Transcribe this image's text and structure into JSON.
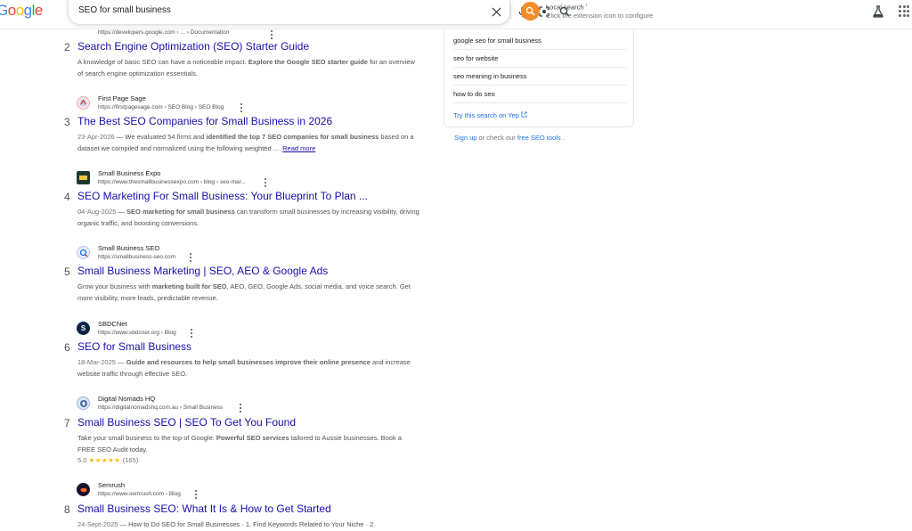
{
  "header": {
    "logo_text": "Google",
    "search_value": "SEO for small business",
    "extension_title": "Local search",
    "extension_info": "i",
    "extension_subtitle": "Click the extension icon to configure",
    "icons": [
      "close-icon",
      "mic-icon",
      "lens-icon",
      "search-icon",
      "labs-icon",
      "apps-icon"
    ]
  },
  "top_partial": {
    "url": "https://developers.google.com › ... › Documentation"
  },
  "results": [
    {
      "num": "2",
      "title": "Search Engine Optimization (SEO) Starter Guide",
      "snippet_plain": "A knowledge of basic SEO can have a noticeable impact. ",
      "snippet_bold": "Explore the Google SEO starter guide",
      "snippet_tail": " for an overview of search engine optimization essentials."
    },
    {
      "num": "3",
      "site_name": "First Page Sage",
      "site_url": "https://firstpagesage.com › SEO Blog › SEO Blog",
      "title": "The Best SEO Companies for Small Business in 2026",
      "date": "23-Apr-2026",
      "snippet_plain": " — We evaluated 54 firms and ",
      "snippet_bold": "identified the top 7 SEO companies for small business",
      "snippet_tail": " based on a dataset we compiled and normalized using the following weighted ...",
      "read_more": "Read more"
    },
    {
      "num": "4",
      "site_name": "Small Business Expo",
      "site_url": "https://www.thesmallbusinessexpo.com › blog › seo-mar...",
      "title": "SEO Marketing For Small Business: Your Blueprint To Plan ...",
      "date": "04-Aug-2025",
      "snippet_plain": " — ",
      "snippet_bold": "SEO marketing for small business",
      "snippet_tail": " can transform small businesses by increasing visibility, driving organic traffic, and boosting conversions."
    },
    {
      "num": "5",
      "site_name": "Small Business SEO",
      "site_url": "https://smallbusiness-seo.com",
      "title": "Small Business Marketing | SEO, AEO & Google Ads",
      "snippet_plain": "Grow your business with ",
      "snippet_bold": "marketing built for SEO",
      "snippet_tail": ", AEO, GEO, Google Ads, social media, and voice search. Get more visibility, more leads, predictable revenue."
    },
    {
      "num": "6",
      "site_name": "SBDCNet",
      "site_url": "https://www.sbdcnet.org › Blog",
      "title": "SEO for Small Business",
      "date": "18-Mar-2025",
      "snippet_plain": " — ",
      "snippet_bold": "Guide and resources to help small businesses improve their online presence",
      "snippet_tail": " and increase website traffic through effective SEO."
    },
    {
      "num": "7",
      "site_name": "Digital Nomads HQ",
      "site_url": "https://digitalnomadshq.com.au › Small Business",
      "title": "Small Business SEO | SEO To Get You Found",
      "snippet_plain": "Take your small business to the top of Google. ",
      "snippet_bold": "Powerful SEO services",
      "snippet_tail": " tailored to Aussie businesses. Book a FREE SEO Audit today.",
      "rating_value": "5.0",
      "rating_stars": "★★★★★",
      "rating_count": "(165)"
    },
    {
      "num": "8",
      "site_name": "Semrush",
      "site_url": "https://www.semrush.com › Blog",
      "title": "Small Business SEO: What It Is & How to Get Started",
      "date": "24-Sept-2025",
      "snippet_plain": " — How to Do SEO for Small Businesses · 1. Find Keywords Related to Your Niche · 2."
    }
  ],
  "right_panel": {
    "related": [
      "google seo for small business",
      "seo for website",
      "seo meaning in business",
      "how to do seo"
    ],
    "yep_link": "Try this search on Yep",
    "signup": "Sign up",
    "or_check": " or check our ",
    "tools_link": "free SEO tools",
    "period": "."
  },
  "colors": {
    "link": "#1a0dab",
    "accent_blue": "#1a73e8",
    "local_search_orange": "#f48c2a",
    "star": "#fbbc04"
  }
}
